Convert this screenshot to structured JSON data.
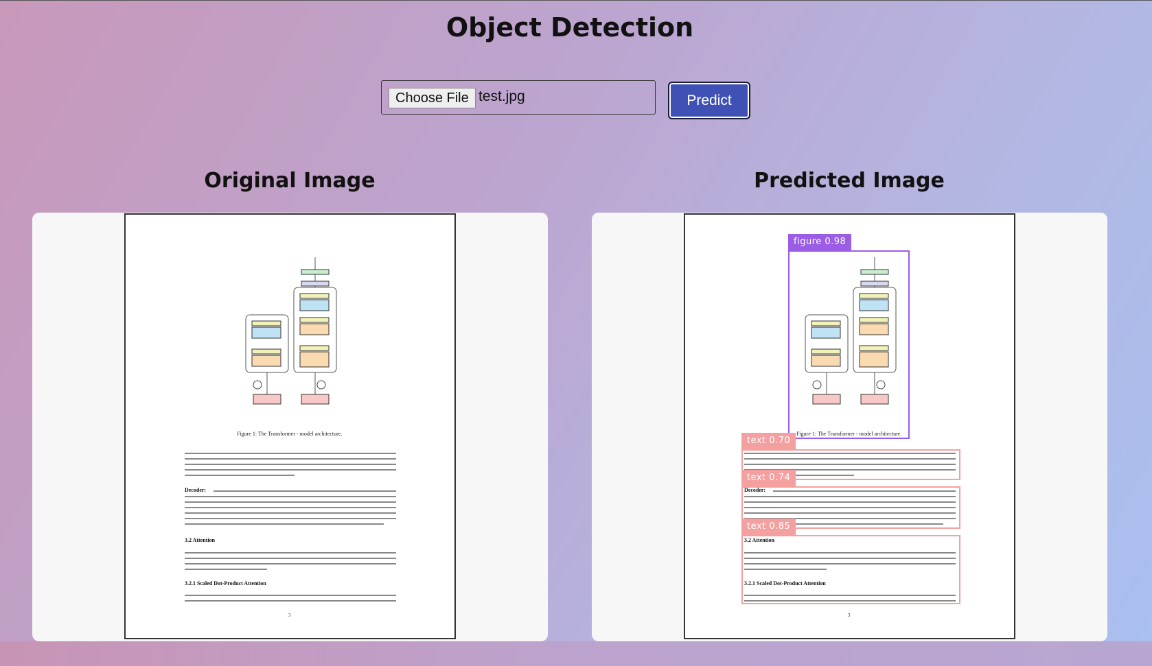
{
  "page_title": "Object Detection",
  "upload": {
    "choose_label": "Choose File",
    "file_name": "test.jpg"
  },
  "predict_label": "Predict",
  "original": {
    "title": "Original Image"
  },
  "predicted": {
    "title": "Predicted Image"
  },
  "doc": {
    "figure_caption": "Figure 1: The Transformer - model architecture.",
    "decoder_heading": "Decoder:",
    "section_heading": "3.2    Attention",
    "subsection_heading": "3.2.1    Scaled Dot-Product Attention",
    "page_number": "3"
  },
  "detections": [
    {
      "label": "figure 0.98",
      "color": "#9b5de5"
    },
    {
      "label": "text 0.70",
      "color": "#f4a0a0"
    },
    {
      "label": "text 0.74",
      "color": "#f4a0a0"
    },
    {
      "label": "text 0.85",
      "color": "#f4a0a0"
    }
  ]
}
